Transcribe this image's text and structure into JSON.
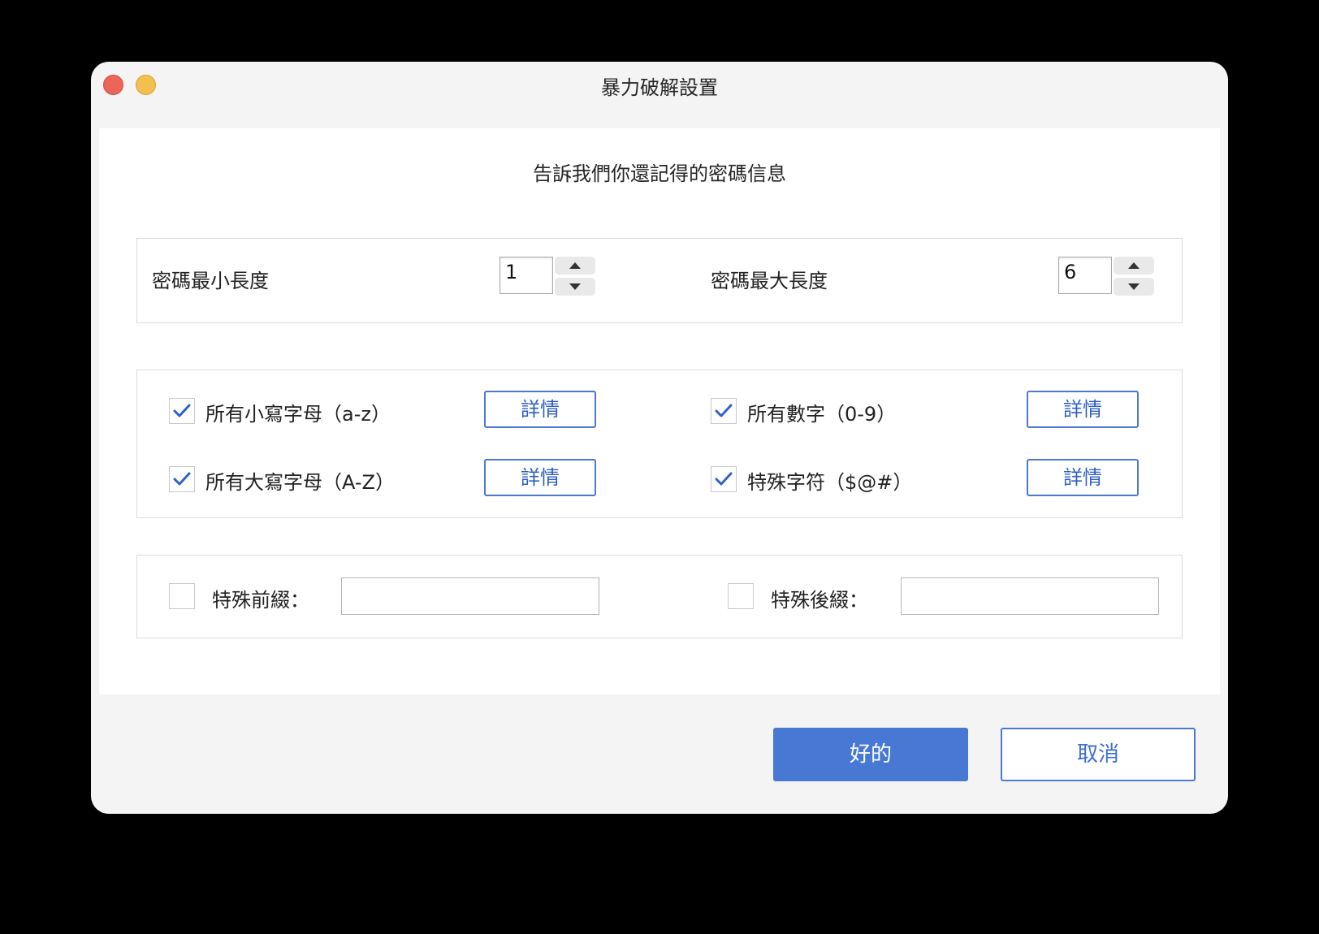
{
  "window": {
    "title": "暴力破解設置"
  },
  "subtitle": "告訴我們你還記得的密碼信息",
  "length": {
    "min_label": "密碼最小長度",
    "min_value": "1",
    "max_label": "密碼最大長度",
    "max_value": "6"
  },
  "charsets": [
    {
      "label": "所有小寫字母（a-z）",
      "checked": true,
      "detail_label": "詳情"
    },
    {
      "label": "所有數字（0-9）",
      "checked": true,
      "detail_label": "詳情"
    },
    {
      "label": "所有大寫字母（A-Z）",
      "checked": true,
      "detail_label": "詳情"
    },
    {
      "label": "特殊字符（$@#）",
      "checked": true,
      "detail_label": "詳情"
    }
  ],
  "affix": {
    "prefix_label": "特殊前綴：",
    "prefix_value": "",
    "prefix_checked": false,
    "suffix_label": "特殊後綴：",
    "suffix_value": "",
    "suffix_checked": false
  },
  "buttons": {
    "ok_label": "好的",
    "cancel_label": "取消"
  },
  "colors": {
    "accent": "#4779d4",
    "close": "#ec6559",
    "minimize": "#f3bf4f"
  }
}
